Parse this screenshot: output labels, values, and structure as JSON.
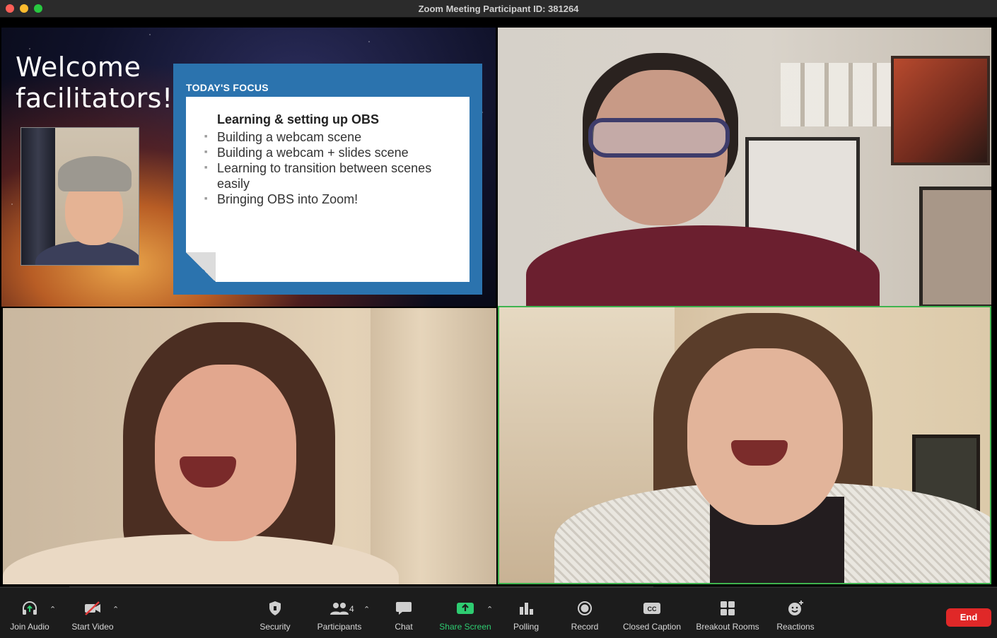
{
  "window": {
    "title": "Zoom Meeting Participant ID: 381264"
  },
  "slide": {
    "welcome": "Welcome facilitators!",
    "card_title": "TODAY'S FOCUS",
    "heading": "Learning & setting up OBS",
    "items": [
      "Building a webcam scene",
      "Building a webcam + slides scene",
      "Learning to transition between scenes easily",
      "Bringing OBS into Zoom!"
    ]
  },
  "toolbar": {
    "join_audio": "Join Audio",
    "start_video": "Start Video",
    "security": "Security",
    "participants": "Participants",
    "participants_count": "4",
    "chat": "Chat",
    "share_screen": "Share Screen",
    "polling": "Polling",
    "record": "Record",
    "closed_caption": "Closed Caption",
    "breakout_rooms": "Breakout Rooms",
    "reactions": "Reactions",
    "end": "End"
  },
  "icons": {
    "join_audio": "headphones-icon",
    "start_video": "video-off-icon",
    "security": "shield-icon",
    "participants": "people-icon",
    "chat": "chat-bubble-icon",
    "share_screen": "share-screen-icon",
    "polling": "bar-chart-icon",
    "record": "record-icon",
    "closed_caption": "cc-icon",
    "breakout_rooms": "grid-icon",
    "reactions": "smiley-plus-icon"
  },
  "colors": {
    "active_speaker_border": "#3fb34f",
    "share_screen": "#2ecc71",
    "end_button": "#e02828",
    "focus_card": "#2b73ae"
  }
}
